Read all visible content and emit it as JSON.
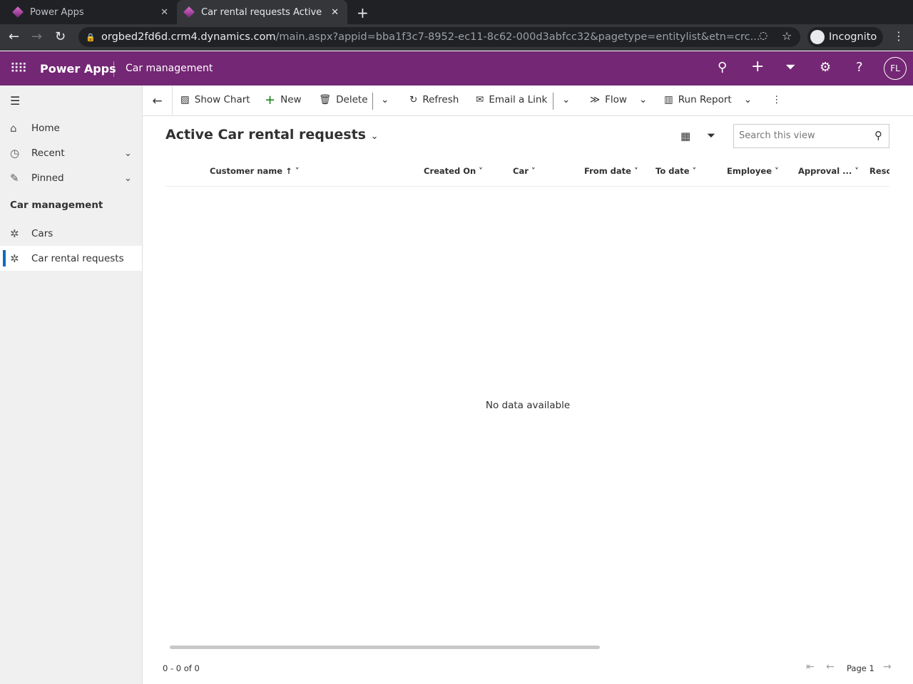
{
  "browser": {
    "tabs": [
      {
        "title": "Power Apps",
        "active": false
      },
      {
        "title": "Car rental requests Active",
        "active": true
      }
    ],
    "url_host": "orgbed2fd6d.crm4.dynamics.com",
    "url_rest": "/main.aspx?appid=bba1f3c7-8952-ec11-8c62-000d3abfcc32&pagetype=entitylist&etn=crc...",
    "incognito_label": "Incognito"
  },
  "appbar": {
    "title": "Power Apps",
    "area": "Car management",
    "avatar": "FL",
    "color": "#742774"
  },
  "sidebar": {
    "items": [
      {
        "label": "Home"
      },
      {
        "label": "Recent"
      },
      {
        "label": "Pinned"
      }
    ],
    "group": "Car management",
    "entities": [
      {
        "label": "Cars"
      },
      {
        "label": "Car rental requests",
        "selected": true
      }
    ]
  },
  "commands": {
    "show_chart": "Show Chart",
    "new": "New",
    "delete": "Delete",
    "refresh": "Refresh",
    "email_link": "Email a Link",
    "flow": "Flow",
    "run_report": "Run Report"
  },
  "view": {
    "title": "Active Car rental requests",
    "search_placeholder": "Search this view",
    "columns": [
      "Customer name",
      "Created On",
      "Car",
      "From date",
      "To date",
      "Employee",
      "Approval ...",
      "Resol"
    ],
    "empty": "No data available",
    "record_count": "0 - 0 of 0",
    "page": "Page 1"
  }
}
